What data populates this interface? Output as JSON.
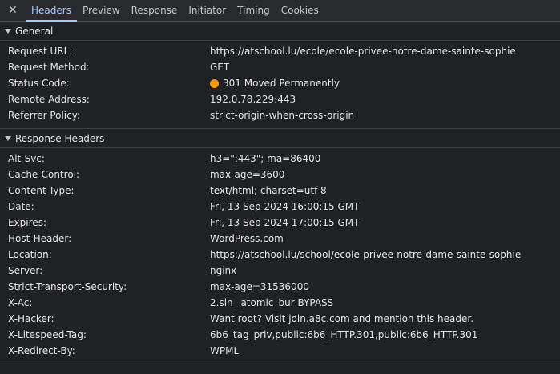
{
  "tabs": {
    "close_glyph": "✕",
    "items": [
      {
        "label": "Headers",
        "active": true
      },
      {
        "label": "Preview"
      },
      {
        "label": "Response"
      },
      {
        "label": "Initiator"
      },
      {
        "label": "Timing"
      },
      {
        "label": "Cookies"
      }
    ]
  },
  "general": {
    "title": "General",
    "rows": [
      {
        "key": "Request URL:",
        "value": "https://atschool.lu/ecole/ecole-privee-notre-dame-sainte-sophie"
      },
      {
        "key": "Request Method:",
        "value": "GET"
      },
      {
        "key": "Status Code:",
        "value": "301 Moved Permanently",
        "status_color": "#f29900"
      },
      {
        "key": "Remote Address:",
        "value": "192.0.78.229:443"
      },
      {
        "key": "Referrer Policy:",
        "value": "strict-origin-when-cross-origin"
      }
    ]
  },
  "response_headers": {
    "title": "Response Headers",
    "rows": [
      {
        "key": "Alt-Svc:",
        "value": "h3=\":443\"; ma=86400"
      },
      {
        "key": "Cache-Control:",
        "value": "max-age=3600"
      },
      {
        "key": "Content-Type:",
        "value": "text/html; charset=utf-8"
      },
      {
        "key": "Date:",
        "value": "Fri, 13 Sep 2024 16:00:15 GMT"
      },
      {
        "key": "Expires:",
        "value": "Fri, 13 Sep 2024 17:00:15 GMT"
      },
      {
        "key": "Host-Header:",
        "value": "WordPress.com"
      },
      {
        "key": "Location:",
        "value": "https://atschool.lu/school/ecole-privee-notre-dame-sainte-sophie"
      },
      {
        "key": "Server:",
        "value": "nginx"
      },
      {
        "key": "Strict-Transport-Security:",
        "value": "max-age=31536000"
      },
      {
        "key": "X-Ac:",
        "value": "2.sin _atomic_bur BYPASS"
      },
      {
        "key": "X-Hacker:",
        "value": "Want root? Visit join.a8c.com and mention this header."
      },
      {
        "key": "X-Litespeed-Tag:",
        "value": "6b6_tag_priv,public:6b6_HTTP.301,public:6b6_HTTP.301"
      },
      {
        "key": "X-Redirect-By:",
        "value": "WPML"
      }
    ]
  }
}
